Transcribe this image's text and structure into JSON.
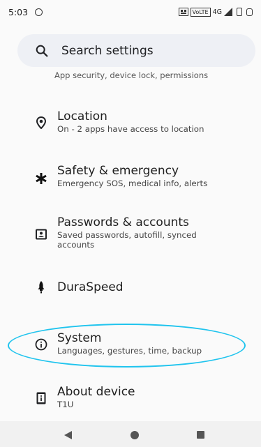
{
  "status_bar": {
    "time": "5:03",
    "network": "4G"
  },
  "search": {
    "placeholder": "Search settings"
  },
  "cutoff_item": {
    "subtitle": "App security, device lock, permissions"
  },
  "settings_items": [
    {
      "icon": "location-pin-icon",
      "title": "Location",
      "subtitle": "On - 2 apps have access to location"
    },
    {
      "icon": "asterisk-icon",
      "title": "Safety & emergency",
      "subtitle": "Emergency SOS, medical info, alerts"
    },
    {
      "icon": "account-box-icon",
      "title": "Passwords & accounts",
      "subtitle": "Saved passwords, autofill, synced",
      "subtitle2": "accounts"
    },
    {
      "icon": "rocket-icon",
      "title": "DuraSpeed",
      "subtitle": ""
    },
    {
      "icon": "info-icon",
      "title": "System",
      "subtitle": "Languages, gestures, time, backup"
    },
    {
      "icon": "device-info-icon",
      "title": "About device",
      "subtitle": "T1U"
    }
  ],
  "colors": {
    "highlight": "#20c4ee",
    "search_bg": "#eef0f5",
    "background": "#fafafa"
  }
}
